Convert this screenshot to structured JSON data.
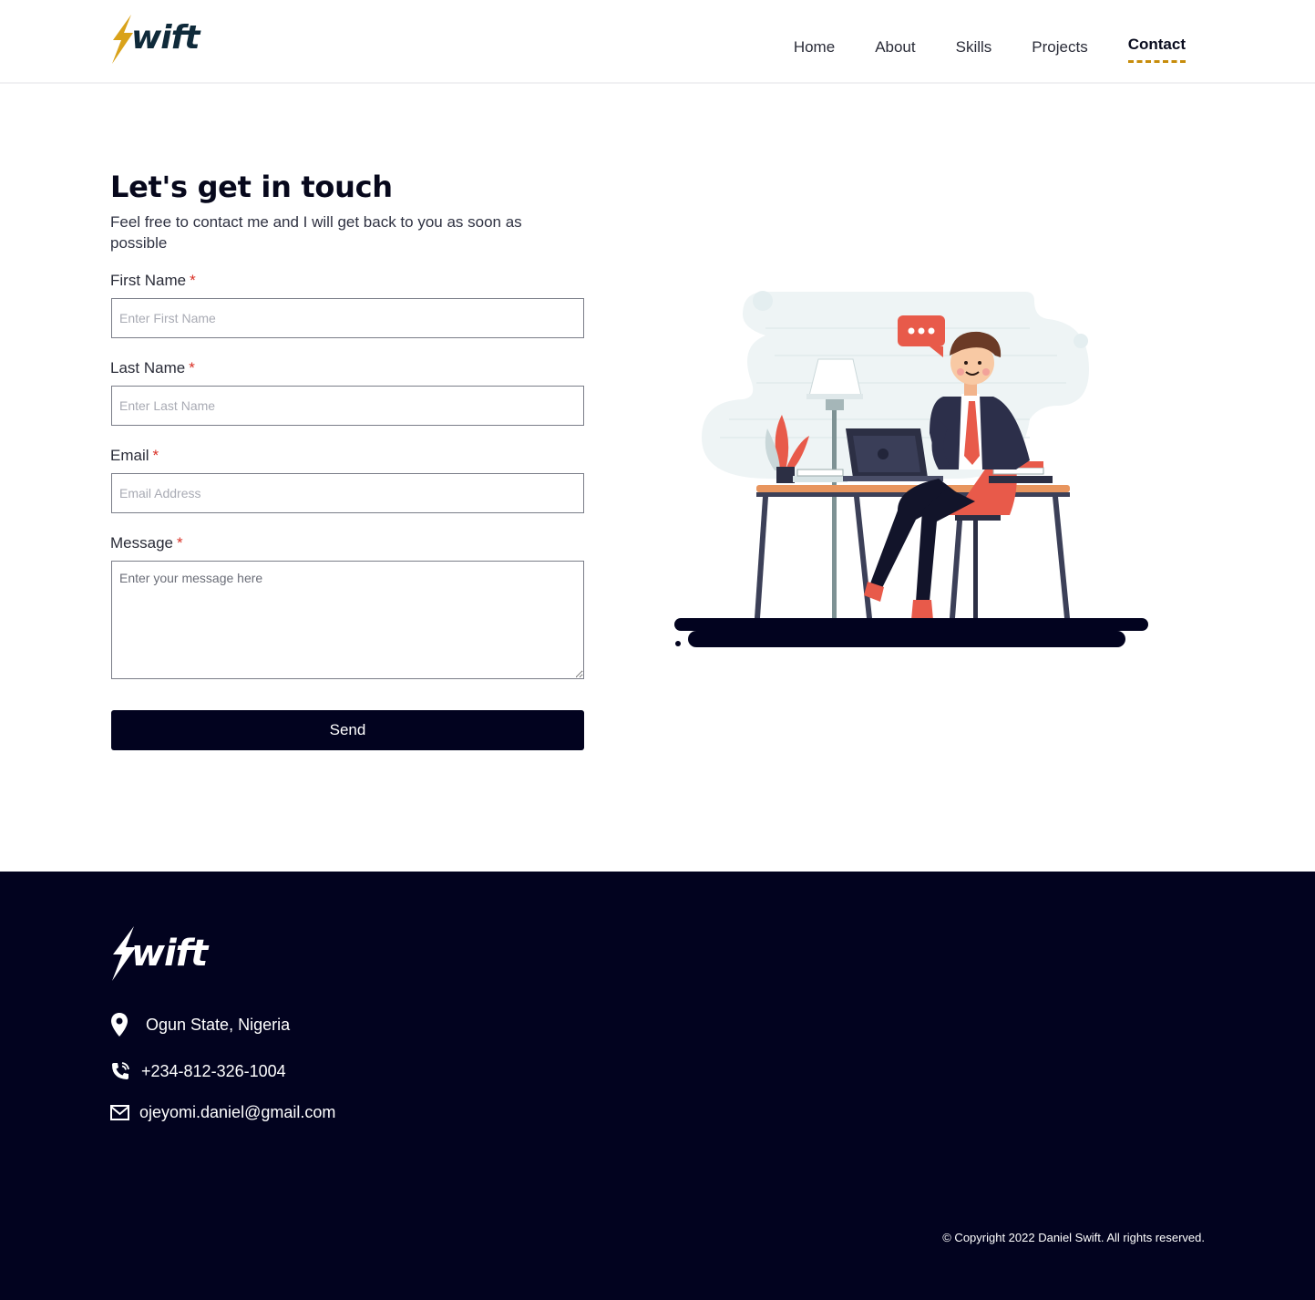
{
  "header": {
    "logo_text": "wift",
    "nav": [
      {
        "label": "Home"
      },
      {
        "label": "About"
      },
      {
        "label": "Skills"
      },
      {
        "label": "Projects"
      },
      {
        "label": "Contact",
        "active": true
      }
    ]
  },
  "contact": {
    "title": "Let's get in touch",
    "subtitle": "Feel free to contact me and I will get back to you as soon as possible",
    "required_mark": "*",
    "first_name": {
      "label": "First Name",
      "placeholder": "Enter First Name",
      "value": ""
    },
    "last_name": {
      "label": "Last Name",
      "placeholder": "Enter Last Name",
      "value": ""
    },
    "email": {
      "label": "Email",
      "placeholder": "Email Address",
      "value": ""
    },
    "message": {
      "label": "Message",
      "placeholder": "Enter your message here",
      "value": ""
    },
    "send_label": "Send",
    "illustration": "man-at-desk-with-laptop-illustration"
  },
  "footer": {
    "logo_text": "wift",
    "location": "Ogun State, Nigeria",
    "phone": "+234-812-326-1004",
    "email": "ojeyomi.daniel@gmail.com",
    "copyright": "© Copyright 2022 Daniel Swift. All rights reserved."
  },
  "colors": {
    "accent": "#c78c0b",
    "navy": "#02031f",
    "required": "#d93025"
  }
}
